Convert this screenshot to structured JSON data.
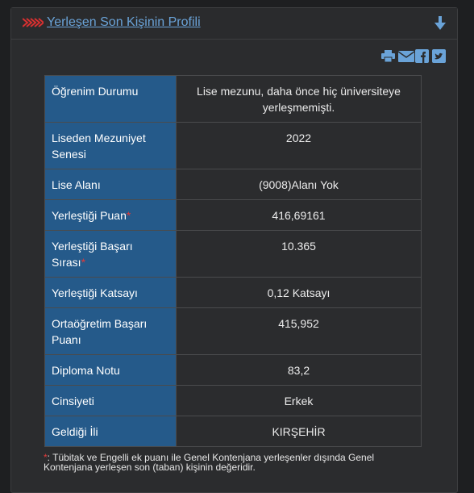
{
  "panel": {
    "title": "Yerleşen Son Kişinin Profili"
  },
  "colors": {
    "header_cells": "#255a8a",
    "accent": "#6aa3d8",
    "required": "#e03a3a"
  },
  "share_icons": [
    "print-icon",
    "mail-icon",
    "facebook-icon",
    "twitter-icon"
  ],
  "rows": [
    {
      "label": "Öğrenim Durumu",
      "value": "Lise mezunu, daha önce hiç üniversiteye yerleşmemişti."
    },
    {
      "label": "Liseden Mezuniyet Senesi",
      "value": "2022"
    },
    {
      "label": "Lise Alanı",
      "value": "(9008)Alanı Yok"
    },
    {
      "label": "Yerleştiği Puan",
      "value": "416,69161"
    },
    {
      "label": "Yerleştiği Başarı Sırası",
      "value": "10.365"
    },
    {
      "label": "Yerleştiği Katsayı",
      "value": "0,12 Katsayı"
    },
    {
      "label": "Ortaöğretim Başarı Puanı",
      "value": "415,952"
    },
    {
      "label": "Diploma Notu",
      "value": "83,2"
    },
    {
      "label": "Cinsiyeti",
      "value": "Erkek"
    },
    {
      "label": "Geldiği İli",
      "value": "KIRŞEHİR"
    }
  ],
  "required_marker": "*",
  "footnote": {
    "marker": "*",
    "text": ": Tübitak ve Engelli ek puanı ile Genel Kontenjana yerleşenler dışında Genel Kontenjana yerleşen son (taban) kişinin değeridir."
  }
}
